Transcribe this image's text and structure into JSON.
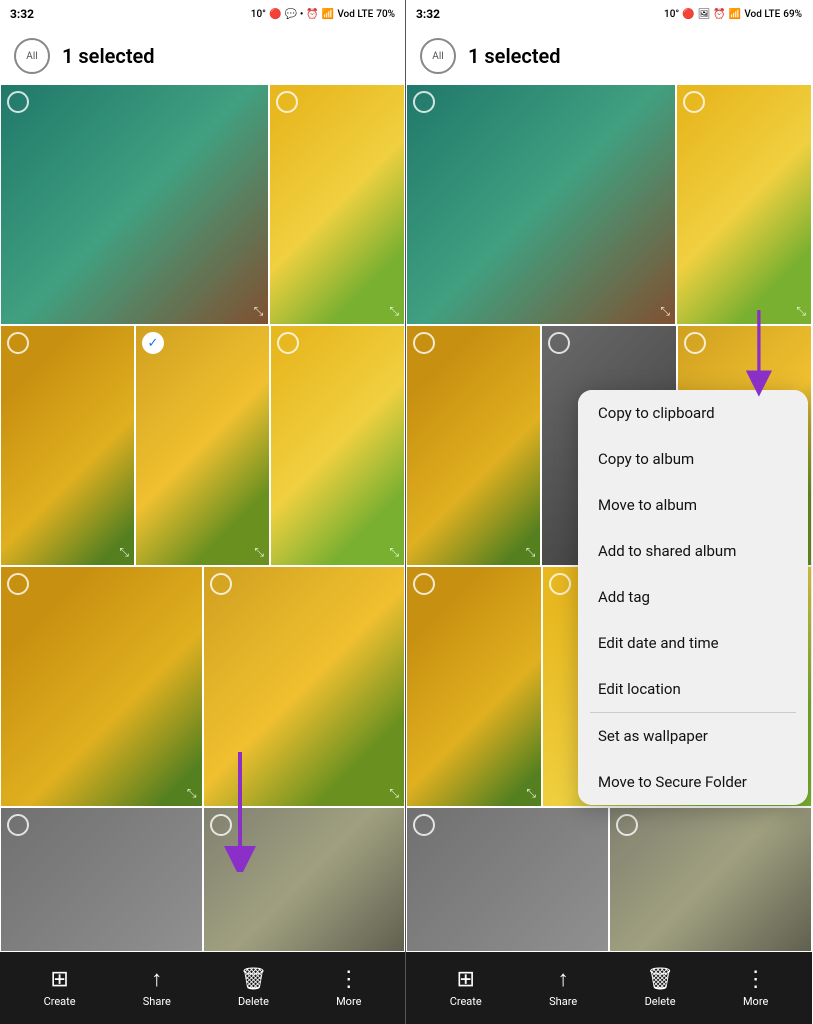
{
  "left_panel": {
    "status": {
      "time": "3:32",
      "temp": "10°",
      "battery": "70%",
      "signal": "Vod LTE"
    },
    "header": {
      "all_label": "All",
      "selected_text": "1 selected"
    },
    "toolbar": {
      "create_label": "Create",
      "share_label": "Share",
      "delete_label": "Delete",
      "more_label": "More"
    },
    "arrow_label": "arrow pointing to delete"
  },
  "right_panel": {
    "status": {
      "time": "3:32",
      "temp": "10°",
      "battery": "69%",
      "signal": "Vod LTE"
    },
    "header": {
      "all_label": "All",
      "selected_text": "1 selected"
    },
    "context_menu": {
      "items": [
        {
          "label": "Copy to clipboard",
          "id": "copy-clipboard"
        },
        {
          "label": "Copy to album",
          "id": "copy-album"
        },
        {
          "label": "Move to album",
          "id": "move-album"
        },
        {
          "label": "Add to shared album",
          "id": "add-shared"
        },
        {
          "label": "Add tag",
          "id": "add-tag"
        },
        {
          "label": "Edit date and time",
          "id": "edit-date"
        },
        {
          "label": "Edit location",
          "id": "edit-location",
          "divider_after": true
        },
        {
          "label": "Set as wallpaper",
          "id": "wallpaper"
        },
        {
          "label": "Move to Secure Folder",
          "id": "secure-folder"
        }
      ]
    },
    "toolbar": {
      "create_label": "Create",
      "share_label": "Share",
      "delete_label": "Delete",
      "more_label": "More"
    }
  }
}
